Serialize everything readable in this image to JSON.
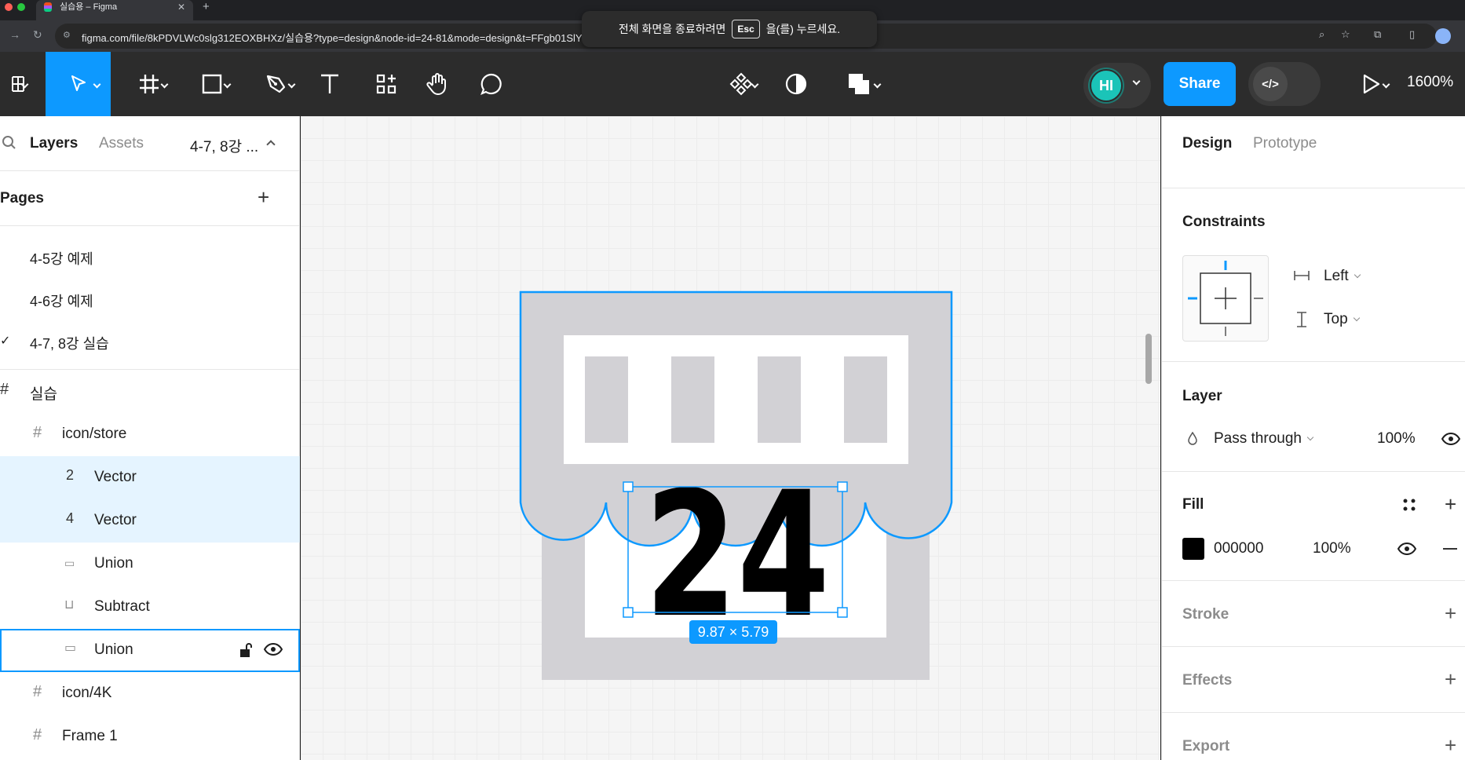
{
  "browser": {
    "tab_title": "실습용 – Figma",
    "tab_close": "✕",
    "new_tab": "+",
    "url": "figma.com/file/8kPDVLWc0slg312EOXBHXz/실습용?type=design&node-id=24-81&mode=design&t=FFgb01SlYbrR21kS-0",
    "fullscreen_toast": {
      "before": "전체 화면을 종료하려면",
      "key": "Esc",
      "after": "을(를) 누르세요."
    }
  },
  "toolbar": {
    "share_label": "Share",
    "avatar_initials": "HI",
    "zoom_level": "1600%",
    "dev_mode_label": "</>"
  },
  "left_panel": {
    "tabs": [
      "Layers",
      "Assets"
    ],
    "current_page_short": "4-7, 8강 ...",
    "pages_title": "Pages",
    "pages": [
      {
        "label": "4-5강 예제",
        "current": false
      },
      {
        "label": "4-6강 예제",
        "current": false
      },
      {
        "label": "4-7, 8강 실습",
        "current": true
      }
    ],
    "current_mark": "✓",
    "layers": [
      {
        "label": "실습",
        "icon": "frame-icon",
        "glyph": "#",
        "indent": 0,
        "state": "normal"
      },
      {
        "label": "icon/store",
        "icon": "frame-icon",
        "glyph": "#",
        "indent": 1,
        "state": "normal"
      },
      {
        "label": "Vector",
        "icon": "vector-2-icon",
        "glyph": "2",
        "indent": 2,
        "state": "selected"
      },
      {
        "label": "Vector",
        "icon": "vector-4-icon",
        "glyph": "4",
        "indent": 2,
        "state": "selected"
      },
      {
        "label": "Union",
        "icon": "union-dots-icon",
        "glyph": "▭",
        "indent": 2,
        "state": "normal"
      },
      {
        "label": "Subtract",
        "icon": "subtract-icon",
        "glyph": "⊔",
        "indent": 2,
        "state": "normal"
      },
      {
        "label": "Union",
        "icon": "union-rect-icon",
        "glyph": "▭",
        "indent": 2,
        "state": "hover"
      },
      {
        "label": "icon/4K",
        "icon": "frame-icon",
        "glyph": "#",
        "indent": 1,
        "state": "normal"
      },
      {
        "label": "Frame 1",
        "icon": "frame-icon",
        "glyph": "#",
        "indent": 1,
        "state": "normal"
      }
    ]
  },
  "canvas": {
    "artwork_text": "24",
    "selection_size": "9.87 × 5.79"
  },
  "right_panel": {
    "tabs": [
      "Design",
      "Prototype"
    ],
    "constraints": {
      "title": "Constraints",
      "horizontal": "Left",
      "vertical": "Top"
    },
    "layer": {
      "title": "Layer",
      "blend": "Pass through",
      "opacity": "100%"
    },
    "fill": {
      "title": "Fill",
      "hex": "000000",
      "opacity": "100%",
      "color": "#000000"
    },
    "stroke_title": "Stroke",
    "effects_title": "Effects",
    "export_title": "Export"
  },
  "colors": {
    "accent": "#0d99ff",
    "toolbar_bg": "#2c2c2c",
    "avatar": "#1bc4b8"
  }
}
